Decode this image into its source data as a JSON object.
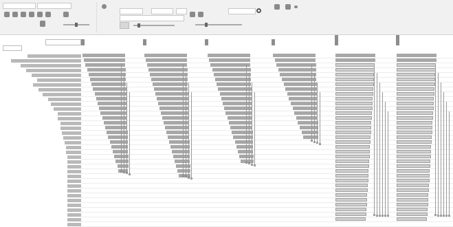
{
  "toolbar": {
    "title_field": "",
    "search_value": ""
  },
  "names": [
    "",
    "",
    "",
    "",
    "",
    "",
    "",
    "",
    "",
    "",
    "",
    "",
    "",
    "",
    "",
    "",
    "",
    "",
    "",
    "",
    "",
    "",
    "",
    "",
    "",
    "",
    "",
    "",
    "",
    "",
    "",
    "",
    "",
    "",
    "",
    ""
  ],
  "periods": [
    "",
    "",
    "",
    "",
    "",
    ""
  ]
}
